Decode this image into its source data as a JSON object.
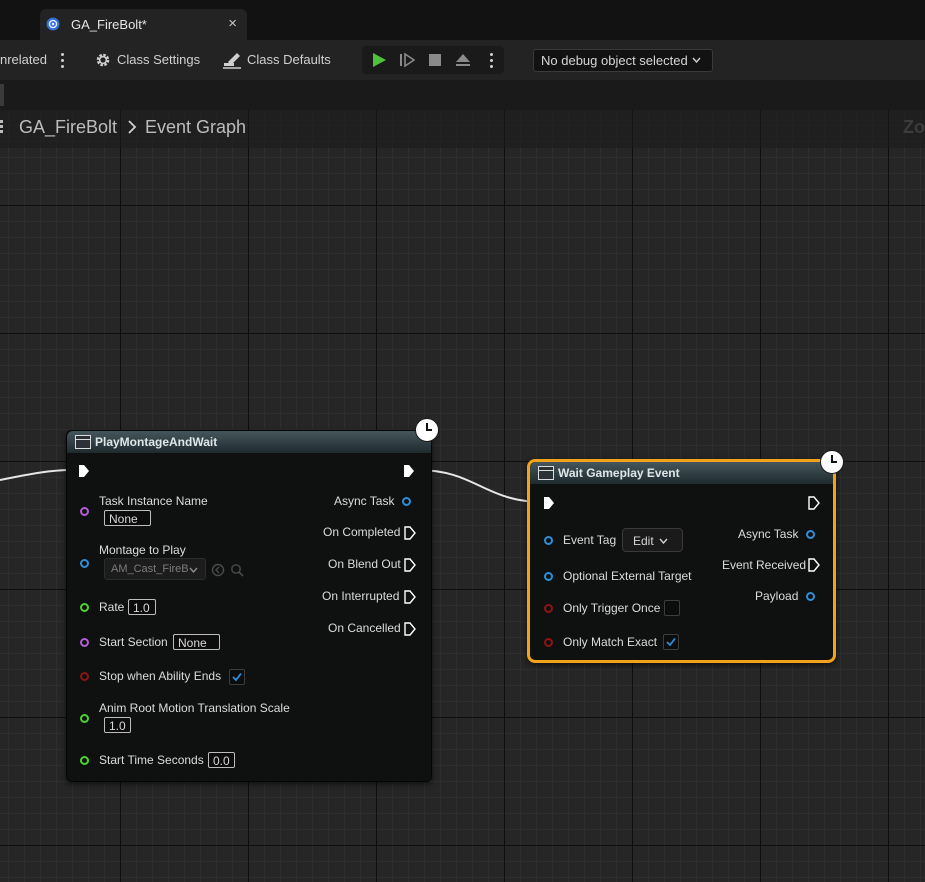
{
  "tab": {
    "title": "GA_FireBolt*",
    "close": "×"
  },
  "toolbar": {
    "partial_label": "nrelated",
    "class_settings": "Class Settings",
    "class_defaults": "Class Defaults",
    "debug_object": "No debug object selected"
  },
  "breadcrumb": {
    "asset": "GA_FireBolt",
    "graph": "Event Graph",
    "zoom": "Zoom"
  },
  "colors": {
    "play_green": "#4ec33a",
    "object_blue": "#2b8fdb",
    "struct_purple": "#b45dd6",
    "float_green": "#4bd32b",
    "bool_red": "#8e1414",
    "selection_orange": "#f2a21b"
  },
  "nodes": {
    "montage": {
      "title": "PlayMontageAndWait",
      "inputs": {
        "task_instance_name": {
          "label": "Task Instance Name",
          "value": "None"
        },
        "montage": {
          "label": "Montage to Play",
          "value": "AM_Cast_FireB"
        },
        "rate": {
          "label": "Rate",
          "value": "1.0"
        },
        "start_section": {
          "label": "Start Section",
          "value": "None"
        },
        "stop_when_ends": {
          "label": "Stop when Ability Ends",
          "checked": true
        },
        "anim_root": {
          "label": "Anim Root Motion Translation Scale",
          "value": "1.0"
        },
        "start_time": {
          "label": "Start Time Seconds",
          "value": "0.0"
        }
      },
      "outputs": {
        "async_task": "Async Task",
        "on_completed": "On Completed",
        "on_blend_out": "On Blend Out",
        "on_interrupted": "On Interrupted",
        "on_cancelled": "On Cancelled"
      }
    },
    "wait": {
      "title": "Wait Gameplay Event",
      "inputs": {
        "event_tag": {
          "label": "Event Tag",
          "button": "Edit"
        },
        "optional_target": {
          "label": "Optional External Target"
        },
        "only_trigger_once": {
          "label": "Only Trigger Once",
          "checked": false
        },
        "only_match_exact": {
          "label": "Only Match Exact",
          "checked": true
        }
      },
      "outputs": {
        "async_task": "Async Task",
        "event_received": "Event Received",
        "payload": "Payload"
      }
    }
  }
}
